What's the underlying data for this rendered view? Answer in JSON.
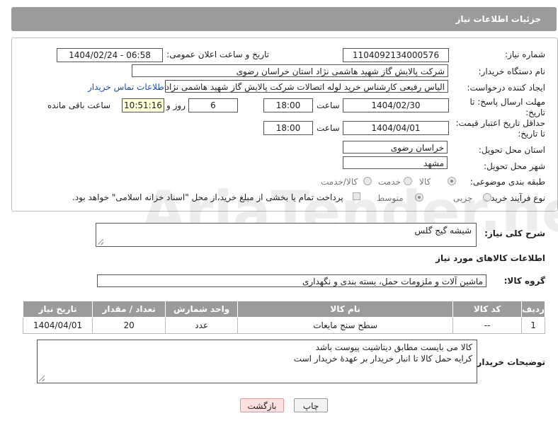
{
  "header": {
    "title": "جزئیات اطلاعات نیاز"
  },
  "form": {
    "need_number_label": "شماره نیاز:",
    "need_number": "1104092134000576",
    "announce_label": "تاریخ و ساعت اعلان عمومی:",
    "announce_value": "1404/02/24 - 06:58",
    "buyer_org_label": "نام دستگاه خریدار:",
    "buyer_org": "شرکت پالایش گاز شهید هاشمی نژاد   استان خراسان رضوی",
    "creator_label": "ایجاد کننده درخواست:",
    "creator": "الیاس رفیعی کارشناس خرید لوله اتصالات شرکت پالایش گاز شهید هاشمی نژاد",
    "contact_link": "اطلاعات تماس خریدار",
    "deadline_label_1": "مهلت ارسال پاسخ: تا",
    "deadline_label_2": "تاریخ:",
    "deadline_date": "1404/02/30",
    "time_label": "ساعت",
    "deadline_time": "18:00",
    "days_value": "6",
    "days_label": "روز و",
    "remaining_time": "10:51:16",
    "remaining_label": "ساعت باقی مانده",
    "price_validity_label_1": "حداقل تاریخ اعتبار قیمت:",
    "price_validity_label_2": "تا تاریخ:",
    "price_validity_date": "1404/04/01",
    "price_validity_time": "18:00",
    "province_label": "استان محل تحویل:",
    "province": "خراسان رضوی",
    "city_label": "شهر محل تحویل:",
    "city": "مشهد",
    "category_label": "طبقه بندی موضوعی:",
    "category_options": [
      "کالا",
      "خدمت",
      "کالا/خدمت"
    ],
    "category_selected": "کالا",
    "process_label": "نوع فرآیند خرید :",
    "process_options": [
      "جزیی",
      "متوسط"
    ],
    "process_note": "پرداخت تمام یا بخشی از مبلغ خرید،از محل \"اسناد خزانه اسلامی\" خواهد بود."
  },
  "description": {
    "label": "شرح کلی نیاز:",
    "value": "شیشه گیج گلس"
  },
  "goods_section": {
    "title": "اطلاعات کالاهای مورد نیاز",
    "group_label": "گروه کالا:",
    "group_value": "ماشین آلات و ملزومات حمل، بسته بندی و نگهداری"
  },
  "table": {
    "headers": [
      "ردیف",
      "کد کالا",
      "نام کالا",
      "واحد شمارش",
      "تعداد / مقدار",
      "تاریخ نیاز"
    ],
    "rows": [
      [
        "1",
        "--",
        "سطح سنج مایعات",
        "عدد",
        "20",
        "1404/04/01"
      ]
    ]
  },
  "buyer_notes": {
    "label": "توضیحات خریدار:",
    "line1": "کالا می بایست مطابق دیتاشیت پیوست باشد",
    "line2": "کرایه حمل کالا تا انبار خریدار بر عهدهٔ خریدار است"
  },
  "buttons": {
    "print": "چاپ",
    "back": "بازگشت"
  },
  "watermark": "AriaTender.neT"
}
